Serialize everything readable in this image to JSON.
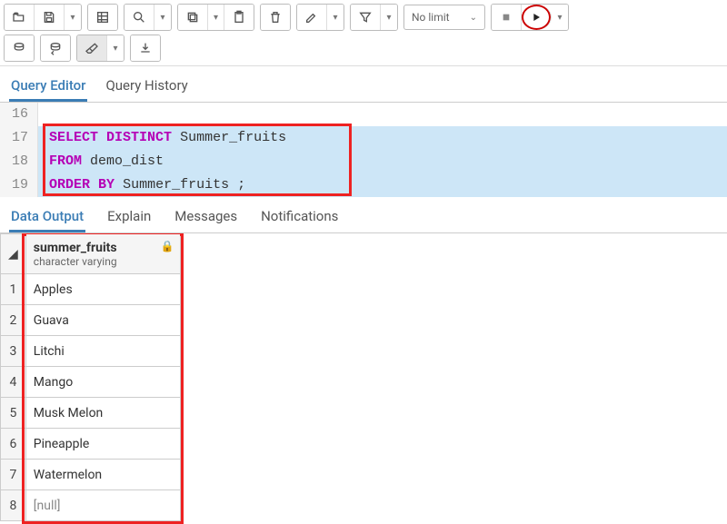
{
  "toolbar": {
    "nolimit_label": "No limit"
  },
  "editorTabs": {
    "queryEditor": "Query Editor",
    "queryHistory": "Query History"
  },
  "editor": {
    "lines": [
      {
        "n": "16",
        "selected": false,
        "tokens": []
      },
      {
        "n": "17",
        "selected": true,
        "tokens": [
          {
            "t": "kw",
            "v": "SELECT"
          },
          {
            "t": "sp",
            "v": " "
          },
          {
            "t": "kw",
            "v": "DISTINCT"
          },
          {
            "t": "sp",
            "v": " "
          },
          {
            "t": "plain",
            "v": "Summer_fruits"
          }
        ]
      },
      {
        "n": "18",
        "selected": true,
        "tokens": [
          {
            "t": "kw",
            "v": "FROM"
          },
          {
            "t": "sp",
            "v": " "
          },
          {
            "t": "plain",
            "v": "demo_dist"
          }
        ]
      },
      {
        "n": "19",
        "selected": true,
        "tokens": [
          {
            "t": "kw",
            "v": "ORDER"
          },
          {
            "t": "sp",
            "v": " "
          },
          {
            "t": "kw",
            "v": "BY"
          },
          {
            "t": "sp",
            "v": " "
          },
          {
            "t": "plain",
            "v": "Summer_fruits ;"
          }
        ]
      }
    ]
  },
  "resultTabs": {
    "dataOutput": "Data Output",
    "explain": "Explain",
    "messages": "Messages",
    "notifications": "Notifications"
  },
  "grid": {
    "column": {
      "name": "summer_fruits",
      "type": "character varying"
    },
    "rows": [
      {
        "n": "1",
        "v": "Apples",
        "null": false
      },
      {
        "n": "2",
        "v": "Guava",
        "null": false
      },
      {
        "n": "3",
        "v": "Litchi",
        "null": false
      },
      {
        "n": "4",
        "v": "Mango",
        "null": false
      },
      {
        "n": "5",
        "v": "Musk Melon",
        "null": false
      },
      {
        "n": "6",
        "v": "Pineapple",
        "null": false
      },
      {
        "n": "7",
        "v": "Watermelon",
        "null": false
      },
      {
        "n": "8",
        "v": "[null]",
        "null": true
      }
    ]
  }
}
